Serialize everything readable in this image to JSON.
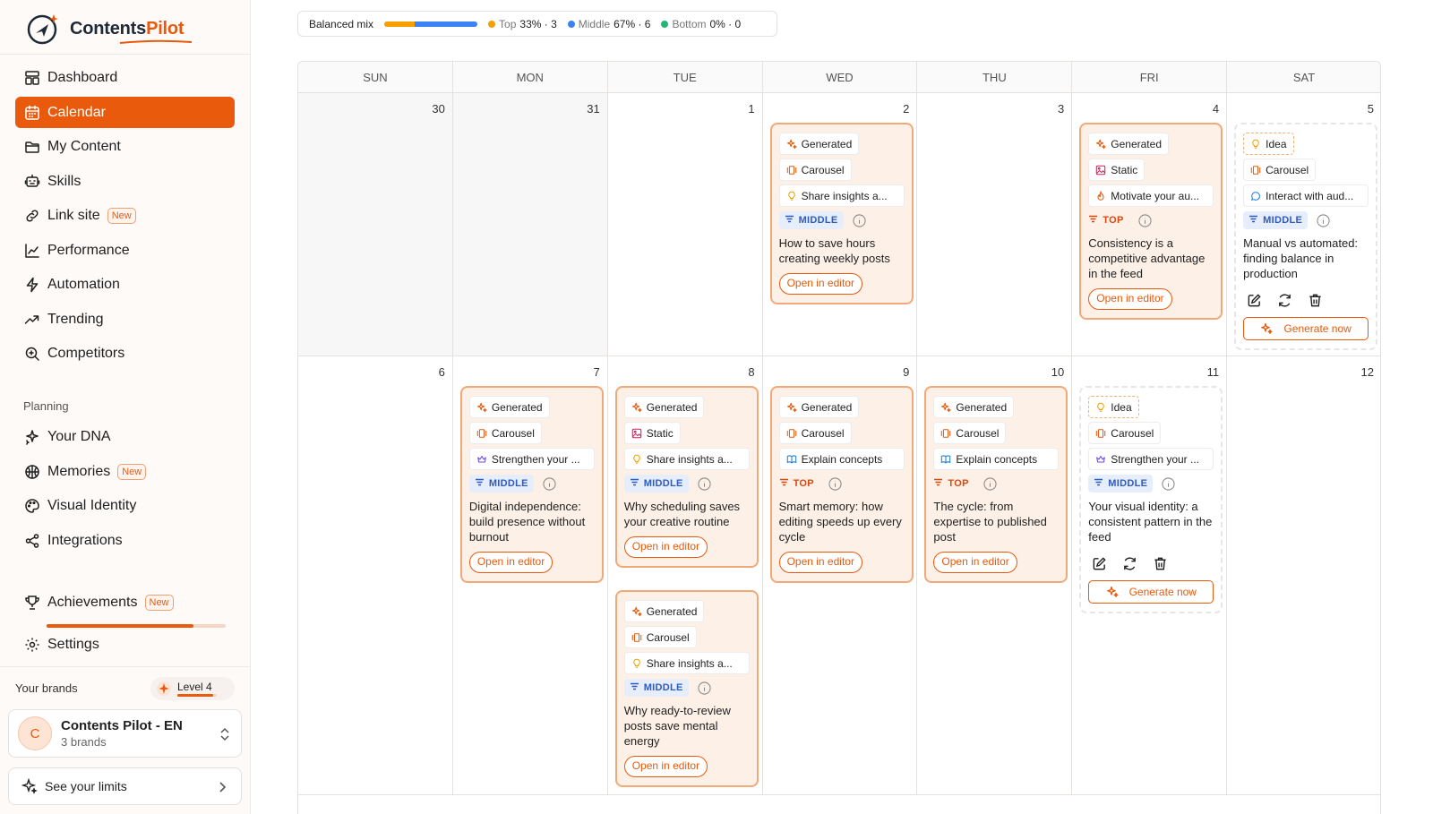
{
  "app": {
    "logo_text_dark": "Contents",
    "logo_text_accent": "Pilot"
  },
  "colors": {
    "accent": "#ea5a0c",
    "top": "#f59f00",
    "middle": "#3b82f6",
    "bottom": "#22b573"
  },
  "sidebar": {
    "main_items": [
      {
        "label": "Dashboard",
        "icon": "dashboard-icon"
      },
      {
        "label": "Calendar",
        "icon": "calendar-icon",
        "active": true
      },
      {
        "label": "My Content",
        "icon": "folder-icon"
      },
      {
        "label": "Skills",
        "icon": "skills-icon"
      },
      {
        "label": "Link site",
        "icon": "link-icon",
        "badge": "New"
      },
      {
        "label": "Performance",
        "icon": "chart-icon"
      },
      {
        "label": "Automation",
        "icon": "bolt-icon"
      },
      {
        "label": "Trending",
        "icon": "trending-icon"
      },
      {
        "label": "Competitors",
        "icon": "search-icon"
      }
    ],
    "planning_label": "Planning",
    "planning_items": [
      {
        "label": "Your DNA",
        "icon": "sparkle-icon"
      },
      {
        "label": "Memories",
        "icon": "brain-icon",
        "badge": "New"
      },
      {
        "label": "Visual Identity",
        "icon": "palette-icon"
      },
      {
        "label": "Integrations",
        "icon": "share-icon"
      }
    ],
    "achievements": {
      "label": "Achievements",
      "badge": "New",
      "progress": 0.82
    },
    "settings_label": "Settings",
    "brands_label": "Your brands",
    "level_label": "Level 4",
    "level_progress": 0.9,
    "brand": {
      "initial": "C",
      "name": "Contents Pilot - EN",
      "sub": "3 brands"
    },
    "limits_label": "See your limits"
  },
  "mix": {
    "title": "Balanced mix",
    "top": {
      "label": "Top",
      "value": "33% · 3",
      "fraction": 0.33
    },
    "middle": {
      "label": "Middle",
      "value": "67% · 6",
      "fraction": 0.67
    },
    "bottom": {
      "label": "Bottom",
      "value": "0% · 0",
      "fraction": 0
    }
  },
  "calendar": {
    "weekdays": [
      "SUN",
      "MON",
      "TUE",
      "WED",
      "THU",
      "FRI",
      "SAT"
    ],
    "weeks": [
      [
        "30",
        "31",
        "1",
        "2",
        "3",
        "4",
        "5"
      ],
      [
        "6",
        "7",
        "8",
        "9",
        "10",
        "11",
        "12"
      ]
    ],
    "outside_month": [
      "30",
      "31"
    ]
  },
  "posts": [
    {
      "day": "2",
      "status": "Generated",
      "format": "Carousel",
      "goal": "Share insights a...",
      "level": "MIDDLE",
      "title": "How to save hours creating weekly posts",
      "action": "Open in editor"
    },
    {
      "day": "4",
      "status": "Generated",
      "format": "Static",
      "goal": "Motivate your au...",
      "level": "TOP",
      "title": "Consistency is a competitive advantage in the feed",
      "action": "Open in editor"
    },
    {
      "day": "5",
      "status": "Idea",
      "format": "Carousel",
      "goal": "Interact with aud...",
      "level": "MIDDLE",
      "title": "Manual vs automated: finding balance in production",
      "action": "Generate now"
    },
    {
      "day": "7",
      "status": "Generated",
      "format": "Carousel",
      "goal": "Strengthen your ...",
      "level": "MIDDLE",
      "title": "Digital independence: build presence without burnout",
      "action": "Open in editor"
    },
    {
      "day": "8",
      "status": "Generated",
      "format": "Static",
      "goal": "Share insights a...",
      "level": "MIDDLE",
      "title": "Why scheduling saves your creative routine",
      "action": "Open in editor"
    },
    {
      "day": "8",
      "status": "Generated",
      "format": "Carousel",
      "goal": "Share insights a...",
      "level": "MIDDLE",
      "title": "Why ready-to-review posts save mental energy",
      "action": "Open in editor"
    },
    {
      "day": "9",
      "status": "Generated",
      "format": "Carousel",
      "goal": "Explain concepts",
      "level": "TOP",
      "title": "Smart memory: how editing speeds up every cycle",
      "action": "Open in editor"
    },
    {
      "day": "10",
      "status": "Generated",
      "format": "Carousel",
      "goal": "Explain concepts",
      "level": "TOP",
      "title": "The cycle: from expertise to published post",
      "action": "Open in editor"
    },
    {
      "day": "11",
      "status": "Idea",
      "format": "Carousel",
      "goal": "Strengthen your ...",
      "level": "MIDDLE",
      "title": "Your visual identity: a consistent pattern in the feed",
      "action": "Generate now"
    }
  ]
}
